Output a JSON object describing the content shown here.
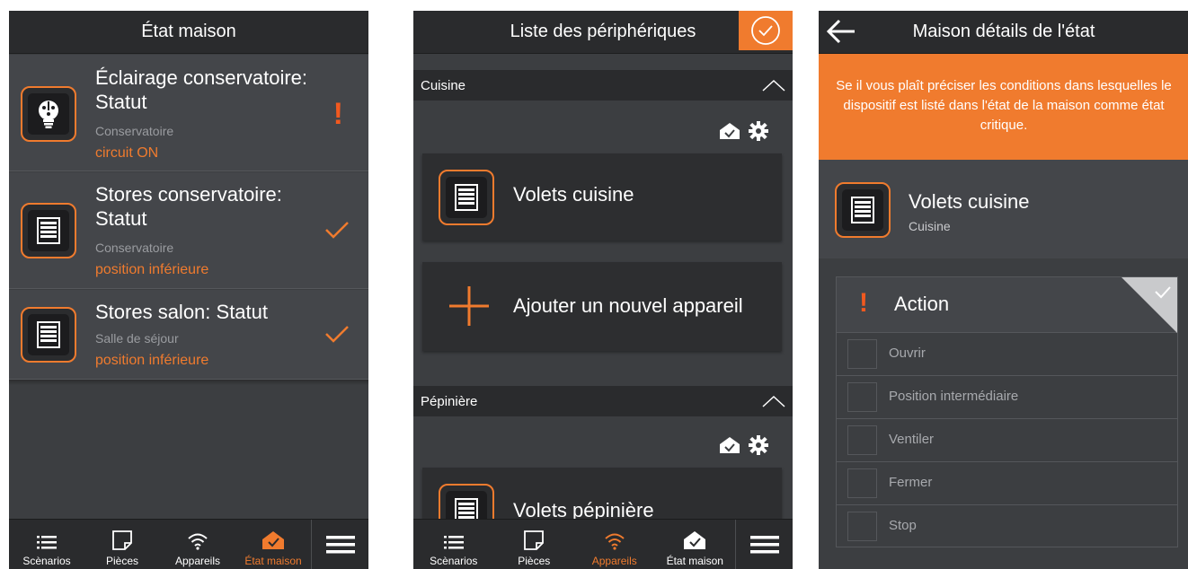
{
  "colors": {
    "accent": "#f07b2e",
    "alert": "#f2591f",
    "bar": "#2a2b2d",
    "panel": "#3c3e41"
  },
  "screen1": {
    "title": "État maison",
    "items": [
      {
        "title": "Éclairage conservatoire: Statut",
        "room": "Conservatoire",
        "status": "circuit ON",
        "icon": "light-bulb-icon",
        "indicator": "alert"
      },
      {
        "title": "Stores conservatoire: Statut",
        "room": "Conservatoire",
        "status": "position inférieure",
        "icon": "shutter-icon",
        "indicator": "check"
      },
      {
        "title": "Stores salon: Statut",
        "room": "Salle de séjour",
        "status": "position inférieure",
        "icon": "shutter-icon",
        "indicator": "check"
      }
    ],
    "nav": {
      "scenarios": "Scènarios",
      "rooms": "Pièces",
      "devices": "Appareils",
      "home": "État maison",
      "active": "home"
    }
  },
  "screen2": {
    "title": "Liste des périphériques",
    "sections": [
      {
        "name": "Cuisine",
        "devices": [
          "Volets cuisine"
        ],
        "add_label": "Ajouter un nouvel appareil"
      },
      {
        "name": "Pépinière",
        "devices": [
          "Volets pépinière"
        ]
      }
    ],
    "nav": {
      "scenarios": "Scènarios",
      "rooms": "Pièces",
      "devices": "Appareils",
      "home": "État maison",
      "active": "devices"
    }
  },
  "screen3": {
    "title": "Maison détails de l'état",
    "banner": "Se il vous plaît préciser les conditions dans lesquelles le dispositif est listé dans l'état de la maison comme état critique.",
    "device": {
      "name": "Volets cuisine",
      "room": "Cuisine"
    },
    "action": {
      "title": "Action",
      "options": [
        "Ouvrir",
        "Position intermédiaire",
        "Ventiler",
        "Fermer",
        "Stop"
      ]
    }
  }
}
